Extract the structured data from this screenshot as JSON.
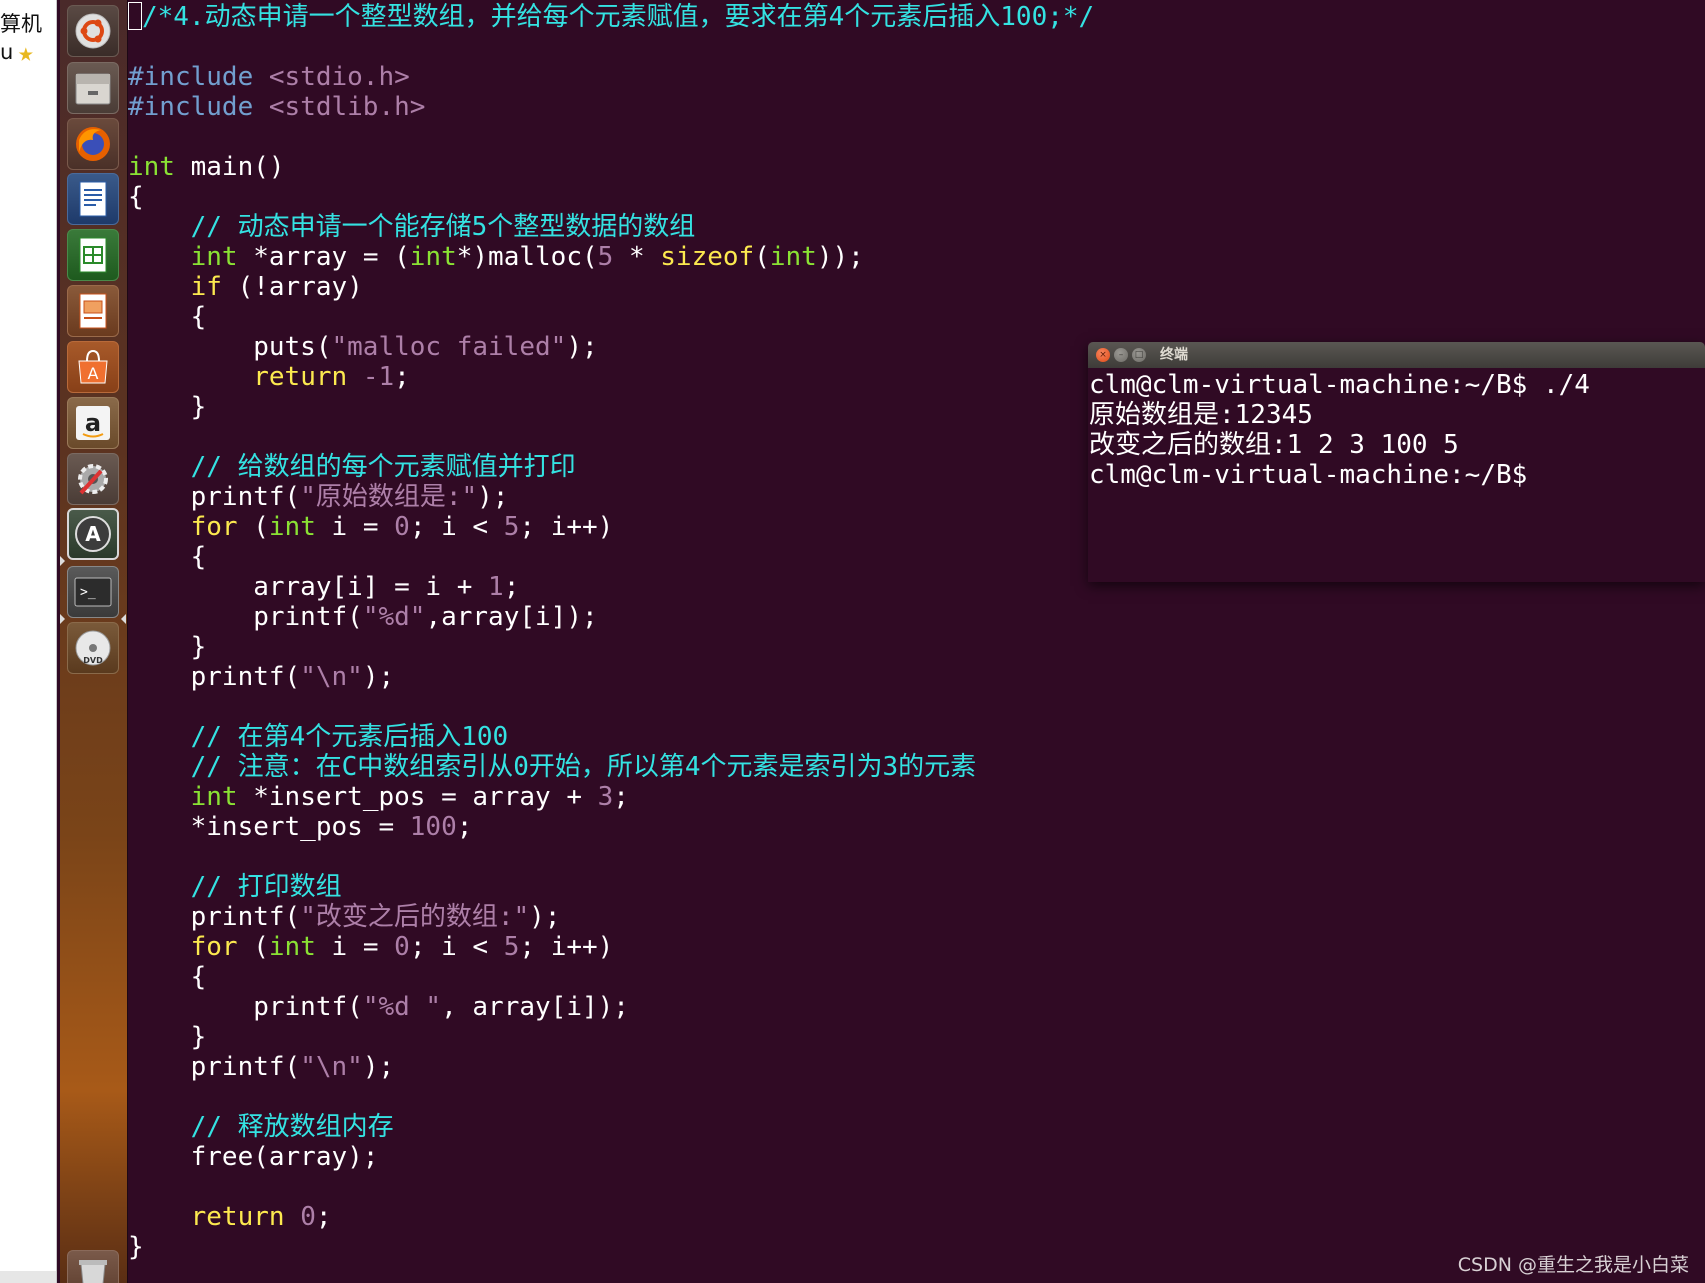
{
  "left_window": {
    "text_line1": "算机",
    "text_line2": "u"
  },
  "launcher": {
    "items": [
      {
        "name": "ubuntu-dash-icon"
      },
      {
        "name": "file-manager-icon"
      },
      {
        "name": "firefox-icon"
      },
      {
        "name": "libreoffice-writer-icon"
      },
      {
        "name": "libreoffice-calc-icon"
      },
      {
        "name": "libreoffice-impress-icon"
      },
      {
        "name": "ubuntu-software-center-icon"
      },
      {
        "name": "amazon-icon"
      },
      {
        "name": "system-settings-icon"
      },
      {
        "name": "software-updater-icon"
      },
      {
        "name": "terminal-icon"
      },
      {
        "name": "dvd-icon"
      },
      {
        "name": "trash-icon"
      }
    ]
  },
  "editor": {
    "lines": [
      [
        {
          "t": "/*4.动态申请一个整型数组，并给每个元素赋值，要求在第4个元素后插入100;*/",
          "c": "comment"
        }
      ],
      [],
      [
        {
          "t": "#include ",
          "c": "pre"
        },
        {
          "t": "<stdio.h>",
          "c": "str"
        }
      ],
      [
        {
          "t": "#include ",
          "c": "pre"
        },
        {
          "t": "<stdlib.h>",
          "c": "str"
        }
      ],
      [],
      [
        {
          "t": "int",
          "c": "type"
        },
        {
          "t": " main()",
          "c": "plain"
        }
      ],
      [
        {
          "t": "{",
          "c": "plain"
        }
      ],
      [
        {
          "t": "    // 动态申请一个能存储5个整型数据的数组",
          "c": "comment"
        }
      ],
      [
        {
          "t": "    ",
          "c": "plain"
        },
        {
          "t": "int",
          "c": "type"
        },
        {
          "t": " *array = (",
          "c": "plain"
        },
        {
          "t": "int",
          "c": "type"
        },
        {
          "t": "*)malloc(",
          "c": "plain"
        },
        {
          "t": "5",
          "c": "num"
        },
        {
          "t": " * ",
          "c": "plain"
        },
        {
          "t": "sizeof",
          "c": "kw"
        },
        {
          "t": "(",
          "c": "plain"
        },
        {
          "t": "int",
          "c": "type"
        },
        {
          "t": "));",
          "c": "plain"
        }
      ],
      [
        {
          "t": "    ",
          "c": "plain"
        },
        {
          "t": "if",
          "c": "kw"
        },
        {
          "t": " (!array)",
          "c": "plain"
        }
      ],
      [
        {
          "t": "    {",
          "c": "plain"
        }
      ],
      [
        {
          "t": "        puts(",
          "c": "plain"
        },
        {
          "t": "\"malloc failed\"",
          "c": "str"
        },
        {
          "t": ");",
          "c": "plain"
        }
      ],
      [
        {
          "t": "        ",
          "c": "plain"
        },
        {
          "t": "return",
          "c": "kw"
        },
        {
          "t": " ",
          "c": "plain"
        },
        {
          "t": "-1",
          "c": "num"
        },
        {
          "t": ";",
          "c": "plain"
        }
      ],
      [
        {
          "t": "    }",
          "c": "plain"
        }
      ],
      [],
      [
        {
          "t": "    // 给数组的每个元素赋值并打印",
          "c": "comment"
        }
      ],
      [
        {
          "t": "    printf(",
          "c": "plain"
        },
        {
          "t": "\"原始数组是:\"",
          "c": "str"
        },
        {
          "t": ");",
          "c": "plain"
        }
      ],
      [
        {
          "t": "    ",
          "c": "plain"
        },
        {
          "t": "for",
          "c": "kw"
        },
        {
          "t": " (",
          "c": "plain"
        },
        {
          "t": "int",
          "c": "type"
        },
        {
          "t": " i = ",
          "c": "plain"
        },
        {
          "t": "0",
          "c": "num"
        },
        {
          "t": "; i < ",
          "c": "plain"
        },
        {
          "t": "5",
          "c": "num"
        },
        {
          "t": "; i++)",
          "c": "plain"
        }
      ],
      [
        {
          "t": "    {",
          "c": "plain"
        }
      ],
      [
        {
          "t": "        array[i] = i + ",
          "c": "plain"
        },
        {
          "t": "1",
          "c": "num"
        },
        {
          "t": ";",
          "c": "plain"
        }
      ],
      [
        {
          "t": "        printf(",
          "c": "plain"
        },
        {
          "t": "\"%d\"",
          "c": "str"
        },
        {
          "t": ",array[i]);",
          "c": "plain"
        }
      ],
      [
        {
          "t": "    }",
          "c": "plain"
        }
      ],
      [
        {
          "t": "    printf(",
          "c": "plain"
        },
        {
          "t": "\"\\n\"",
          "c": "str"
        },
        {
          "t": ");",
          "c": "plain"
        }
      ],
      [],
      [
        {
          "t": "    // 在第4个元素后插入100",
          "c": "comment"
        }
      ],
      [
        {
          "t": "    // 注意：在C中数组索引从0开始，所以第4个元素是索引为3的元素",
          "c": "comment"
        }
      ],
      [
        {
          "t": "    ",
          "c": "plain"
        },
        {
          "t": "int",
          "c": "type"
        },
        {
          "t": " *insert_pos = array + ",
          "c": "plain"
        },
        {
          "t": "3",
          "c": "num"
        },
        {
          "t": ";",
          "c": "plain"
        }
      ],
      [
        {
          "t": "    *insert_pos = ",
          "c": "plain"
        },
        {
          "t": "100",
          "c": "num"
        },
        {
          "t": ";",
          "c": "plain"
        }
      ],
      [],
      [
        {
          "t": "    // 打印数组",
          "c": "comment"
        }
      ],
      [
        {
          "t": "    printf(",
          "c": "plain"
        },
        {
          "t": "\"改变之后的数组:\"",
          "c": "str"
        },
        {
          "t": ");",
          "c": "plain"
        }
      ],
      [
        {
          "t": "    ",
          "c": "plain"
        },
        {
          "t": "for",
          "c": "kw"
        },
        {
          "t": " (",
          "c": "plain"
        },
        {
          "t": "int",
          "c": "type"
        },
        {
          "t": " i = ",
          "c": "plain"
        },
        {
          "t": "0",
          "c": "num"
        },
        {
          "t": "; i < ",
          "c": "plain"
        },
        {
          "t": "5",
          "c": "num"
        },
        {
          "t": "; i++)",
          "c": "plain"
        }
      ],
      [
        {
          "t": "    {",
          "c": "plain"
        }
      ],
      [
        {
          "t": "        printf(",
          "c": "plain"
        },
        {
          "t": "\"%d \"",
          "c": "str"
        },
        {
          "t": ", array[i]);",
          "c": "plain"
        }
      ],
      [
        {
          "t": "    }",
          "c": "plain"
        }
      ],
      [
        {
          "t": "    printf(",
          "c": "plain"
        },
        {
          "t": "\"\\n\"",
          "c": "str"
        },
        {
          "t": ");",
          "c": "plain"
        }
      ],
      [],
      [
        {
          "t": "    // 释放数组内存",
          "c": "comment"
        }
      ],
      [
        {
          "t": "    free(array);",
          "c": "plain"
        }
      ],
      [],
      [
        {
          "t": "    ",
          "c": "plain"
        },
        {
          "t": "return",
          "c": "kw"
        },
        {
          "t": " ",
          "c": "plain"
        },
        {
          "t": "0",
          "c": "num"
        },
        {
          "t": ";",
          "c": "plain"
        }
      ],
      [
        {
          "t": "}",
          "c": "plain"
        }
      ]
    ]
  },
  "terminal": {
    "title": "终端",
    "close_glyph": "×",
    "min_glyph": "–",
    "max_glyph": "□",
    "lines": [
      "clm@clm-virtual-machine:~/B$ ./4",
      "原始数组是:12345",
      "改变之后的数组:1 2 3 100 5",
      "clm@clm-virtual-machine:~/B$"
    ]
  },
  "watermark": "CSDN @重生之我是小白菜",
  "colors": {
    "background": "#300a24",
    "comment": "#34e2e2",
    "preprocessor": "#729fcf",
    "type": "#8ae234",
    "keyword": "#fce94f",
    "string": "#ad7fa8"
  }
}
